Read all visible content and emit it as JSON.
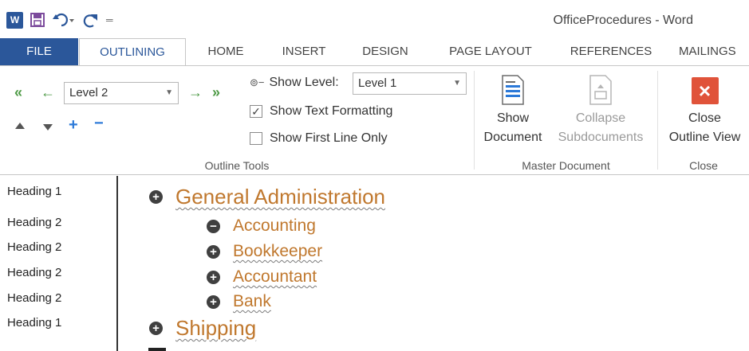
{
  "titlebar": {
    "title": "OfficeProcedures - Word",
    "app_icon_letter": "W"
  },
  "tabs": [
    {
      "label": "FILE"
    },
    {
      "label": "OUTLINING"
    },
    {
      "label": "HOME"
    },
    {
      "label": "INSERT"
    },
    {
      "label": "DESIGN"
    },
    {
      "label": "PAGE LAYOUT"
    },
    {
      "label": "REFERENCES"
    },
    {
      "label": "MAILINGS"
    }
  ],
  "outline_tools": {
    "level_value": "Level 2",
    "show_level_label": "Show Level:",
    "show_level_value": "Level 1",
    "show_text_formatting": "Show Text Formatting",
    "show_text_formatting_checked": true,
    "show_first_line_only": "Show First Line Only",
    "show_first_line_only_checked": false,
    "group_label": "Outline Tools"
  },
  "master_document": {
    "show_document_line1": "Show",
    "show_document_line2": "Document",
    "collapse_line1": "Collapse",
    "collapse_line2": "Subdocuments",
    "group_label": "Master Document"
  },
  "close_group": {
    "close_line1": "Close",
    "close_line2": "Outline View",
    "group_label": "Close"
  },
  "styles": [
    "Heading 1",
    "Heading 2",
    "Heading 2",
    "Heading 2",
    "Heading 2",
    "Heading 1"
  ],
  "outline": [
    {
      "text": "General Administration",
      "level": 1,
      "symbol": "+"
    },
    {
      "text": "Accounting",
      "level": 2,
      "symbol": "−"
    },
    {
      "text": "Bookkeeper",
      "level": 2,
      "symbol": "+"
    },
    {
      "text": "Accountant",
      "level": 2,
      "symbol": "+"
    },
    {
      "text": "Bank",
      "level": 2,
      "symbol": "+"
    },
    {
      "text": "Shipping",
      "level": 1,
      "symbol": "+"
    }
  ],
  "colors": {
    "accent": "#2b579a",
    "heading": "#c0782e",
    "arrow_green": "#4d9a45",
    "close_red": "#e0533a"
  }
}
